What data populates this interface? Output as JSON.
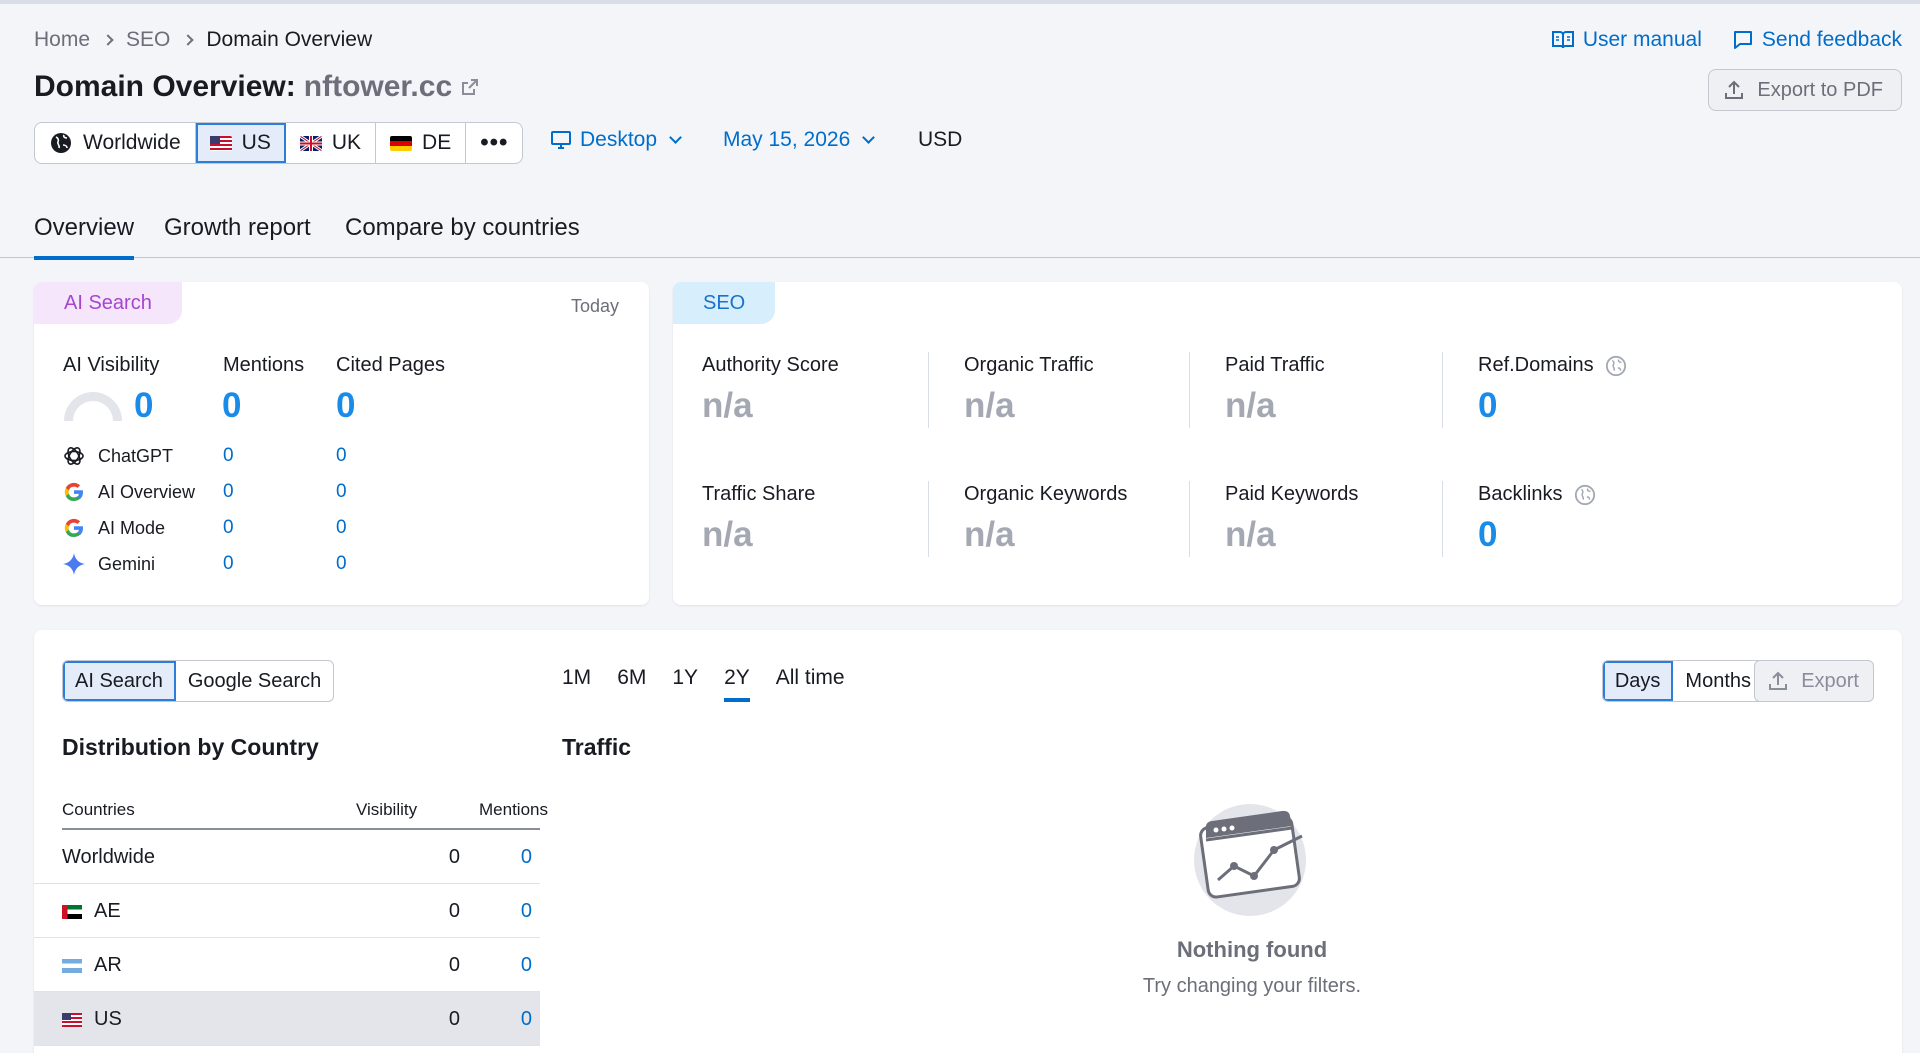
{
  "breadcrumb": {
    "home": "Home",
    "seo": "SEO",
    "current": "Domain Overview"
  },
  "top_links": {
    "user_manual": "User manual",
    "send_feedback": "Send feedback"
  },
  "title": {
    "prefix": "Domain Overview:",
    "domain": "nftower.cc"
  },
  "export_pdf": "Export to PDF",
  "databases": {
    "worldwide": "Worldwide",
    "us": "US",
    "uk": "UK",
    "de": "DE",
    "more": "•••"
  },
  "device": "Desktop",
  "date": "May 15, 2026",
  "currency": "USD",
  "tabs": {
    "overview": "Overview",
    "growth": "Growth report",
    "compare": "Compare by countries"
  },
  "ai_card": {
    "label": "AI Search",
    "period": "Today",
    "visibility_label": "AI Visibility",
    "visibility_value": "0",
    "mentions_label": "Mentions",
    "mentions_value": "0",
    "cited_label": "Cited Pages",
    "cited_value": "0",
    "engines": [
      {
        "name": "ChatGPT",
        "mentions": "0",
        "cited": "0"
      },
      {
        "name": "AI Overview",
        "mentions": "0",
        "cited": "0"
      },
      {
        "name": "AI Mode",
        "mentions": "0",
        "cited": "0"
      },
      {
        "name": "Gemini",
        "mentions": "0",
        "cited": "0"
      }
    ]
  },
  "seo_card": {
    "label": "SEO",
    "authority_label": "Authority Score",
    "authority_value": "n/a",
    "organic_traffic_label": "Organic Traffic",
    "organic_traffic_value": "n/a",
    "paid_traffic_label": "Paid Traffic",
    "paid_traffic_value": "n/a",
    "ref_domains_label": "Ref.Domains",
    "ref_domains_value": "0",
    "traffic_share_label": "Traffic Share",
    "traffic_share_value": "n/a",
    "organic_keywords_label": "Organic Keywords",
    "organic_keywords_value": "n/a",
    "paid_keywords_label": "Paid Keywords",
    "paid_keywords_value": "n/a",
    "backlinks_label": "Backlinks",
    "backlinks_value": "0"
  },
  "bottom": {
    "source_toggle": {
      "ai": "AI Search",
      "google": "Google Search"
    },
    "ranges": {
      "m1": "1M",
      "m6": "6M",
      "y1": "1Y",
      "y2": "2Y",
      "all": "All time"
    },
    "granularity": {
      "days": "Days",
      "months": "Months"
    },
    "export": "Export",
    "distribution_title": "Distribution by Country",
    "traffic_title": "Traffic",
    "table": {
      "col_countries": "Countries",
      "col_visibility": "Visibility",
      "col_mentions": "Mentions",
      "rows": [
        {
          "country": "Worldwide",
          "visibility": "0",
          "mentions": "0"
        },
        {
          "country": "AE",
          "visibility": "0",
          "mentions": "0"
        },
        {
          "country": "AR",
          "visibility": "0",
          "mentions": "0"
        },
        {
          "country": "US",
          "visibility": "0",
          "mentions": "0"
        }
      ]
    },
    "empty_title": "Nothing found",
    "empty_subtitle": "Try changing your filters."
  },
  "colors": {
    "accent": "#006dca",
    "metric_blue": "#1a8ce8",
    "ai_pill": "#f5e6fb",
    "seo_pill": "#d7eefd"
  }
}
